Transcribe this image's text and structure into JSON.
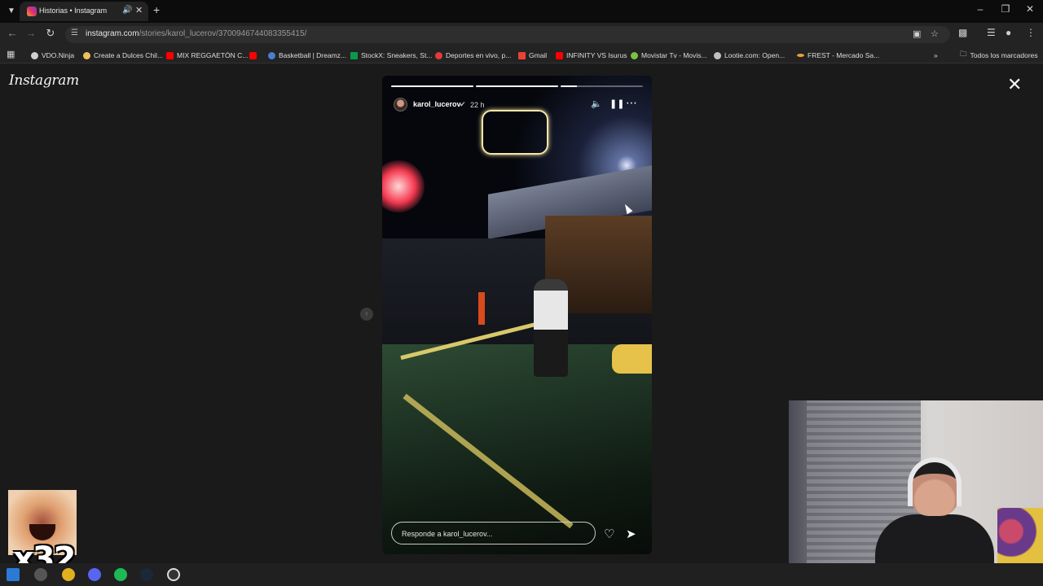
{
  "browser": {
    "tab": {
      "title": "Historias • Instagram"
    },
    "url": {
      "host": "instagram.com",
      "path": "/stories/karol_lucerov/3700946744083355415/"
    },
    "bookmarks": [
      {
        "label": "VDO.Ninja",
        "color": "#cfcfcf"
      },
      {
        "label": "Create a Dulces Chil...",
        "color": "#f0c05a"
      },
      {
        "label": "MIX REGGAETÓN C...",
        "color": "#ff0000"
      },
      {
        "label": "",
        "color": "#ff0000"
      },
      {
        "label": "Basketball | Dreamz...",
        "color": "#4a7fd0"
      },
      {
        "label": "StockX: Sneakers, St...",
        "color": "#0a9a4a"
      },
      {
        "label": "Deportes en vivo, p...",
        "color": "#e43a3a"
      },
      {
        "label": "Gmail",
        "color": "#ea4335"
      },
      {
        "label": "INFINITY VS Isurus",
        "color": "#ff0000"
      },
      {
        "label": "Movistar Tv - Movis...",
        "color": "#7cc243"
      },
      {
        "label": "Lootie.com: Open...",
        "color": "#c0c0c0"
      },
      {
        "label": "FREST - Mercado Sa...",
        "color": "#f0a030"
      }
    ],
    "all_bookmarks_label": "Todos los marcadores"
  },
  "instagram": {
    "logo": "Instagram",
    "story": {
      "username": "karol_lucerov",
      "age": "22 h",
      "progress": [
        1.0,
        1.0,
        0.2
      ],
      "reply_placeholder": "Responde a karol_lucerov..."
    }
  },
  "overlay": {
    "meme_count": "x32"
  },
  "colors": {
    "page_bg": "#1a1a1a",
    "tab_bar": "#0c0c0c",
    "toolbar": "#232323"
  }
}
